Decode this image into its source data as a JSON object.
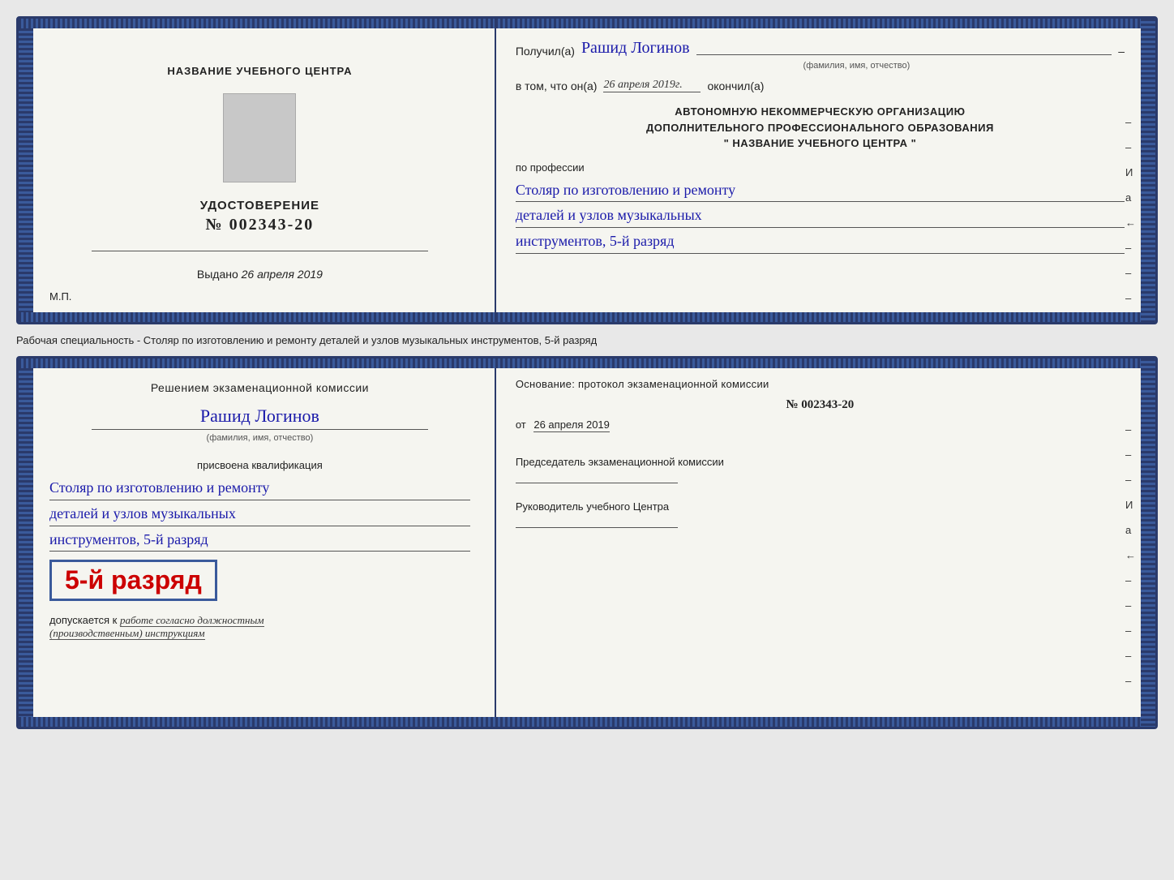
{
  "page": {
    "background": "#e8e8e8"
  },
  "top_doc": {
    "left": {
      "org_name": "НАЗВАНИЕ УЧЕБНОГО ЦЕНТРА",
      "cert_title": "УДОСТОВЕРЕНИЕ",
      "cert_number_prefix": "№",
      "cert_number": "002343-20",
      "issued_label": "Выдано",
      "issued_date": "26 апреля 2019",
      "mp_label": "М.П."
    },
    "right": {
      "received_label": "Получил(а)",
      "recipient_name": "Рашид Логинов",
      "fio_sublabel": "(фамилия, имя, отчество)",
      "date_prefix": "в том, что он(а)",
      "date_value": "26 апреля 2019г.",
      "date_suffix": "окончил(а)",
      "org_line1": "АВТОНОМНУЮ НЕКОММЕРЧЕСКУЮ ОРГАНИЗАЦИЮ",
      "org_line2": "ДОПОЛНИТЕЛЬНОГО ПРОФЕССИОНАЛЬНОГО ОБРАЗОВАНИЯ",
      "org_line3": "\"  НАЗВАНИЕ УЧЕБНОГО ЦЕНТРА  \"",
      "profession_label": "по профессии",
      "profession_line1": "Столяр по изготовлению и ремонту",
      "profession_line2": "деталей и узлов музыкальных",
      "profession_line3": "инструментов, 5-й разряд"
    }
  },
  "specialty_line": {
    "label": "Рабочая специальность - Столяр по изготовлению и ремонту деталей и узлов музыкальных инструментов, 5-й разряд"
  },
  "bottom_doc": {
    "left": {
      "decision_label": "Решением экзаменационной комиссии",
      "person_name": "Рашид Логинов",
      "fio_sublabel": "(фамилия, имя, отчество)",
      "qualification_label": "присвоена квалификация",
      "qualification_line1": "Столяр по изготовлению и ремонту",
      "qualification_line2": "деталей и узлов музыкальных",
      "qualification_line3": "инструментов, 5-й разряд",
      "grade_text": "5-й разряд",
      "dopuskaetsya_label": "допускается к",
      "work_instruction": "работе согласно должностным",
      "production_instruction": "(производственным) инструкциям"
    },
    "right": {
      "basis_label": "Основание: протокол экзаменационной комиссии",
      "protocol_number": "№ 002343-20",
      "protocol_date_prefix": "от",
      "protocol_date": "26 апреля 2019",
      "chairman_label": "Председатель экзаменационной комиссии",
      "director_label": "Руководитель учебного Центра"
    }
  },
  "side_marks": {
    "mark1": "И",
    "mark2": "а",
    "mark3": "←",
    "mark4": "–",
    "mark5": "–",
    "mark6": "–",
    "mark7": "–"
  }
}
